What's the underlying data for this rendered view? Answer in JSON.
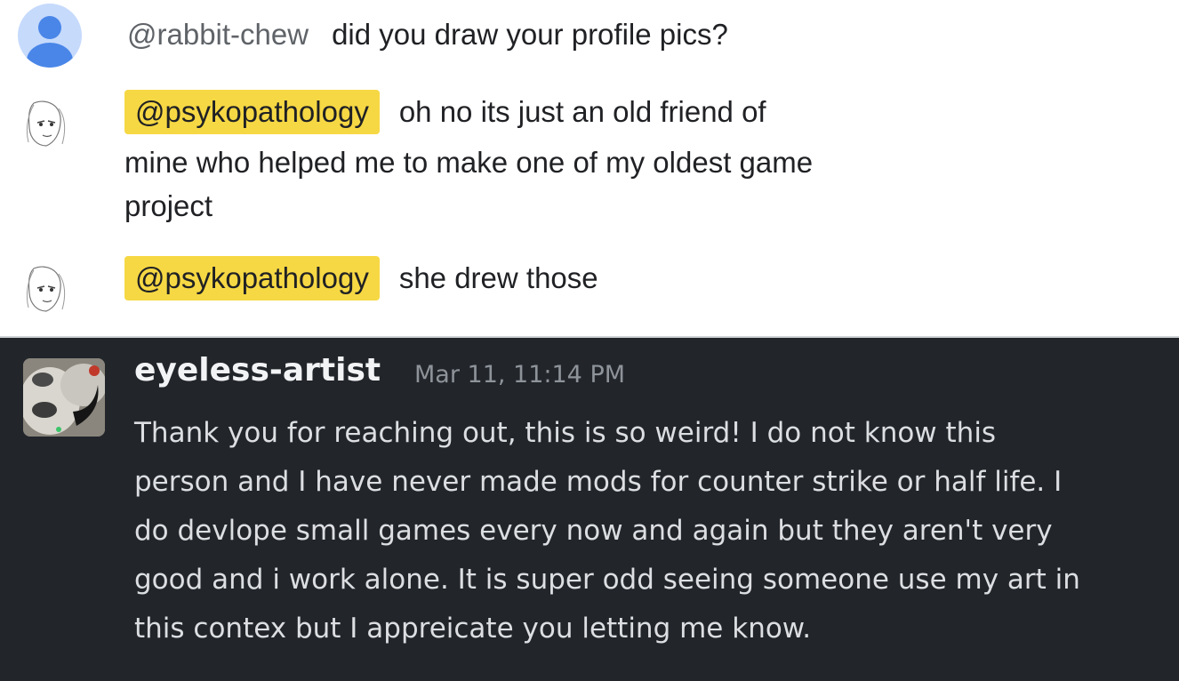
{
  "messages": [
    {
      "mention": "@rabbit-chew",
      "text": "did you draw your profile pics?"
    },
    {
      "mention": "@psykopathology",
      "lines": [
        "oh no its just an old friend of",
        "mine who helped me to make one of my oldest game",
        "project"
      ]
    },
    {
      "mention": "@psykopathology",
      "text": "she drew those"
    }
  ],
  "reply": {
    "username": "eyeless-artist",
    "timestamp": "Mar 11, 11:14 PM",
    "lines": [
      "Thank you for reaching out, this is so weird! I do not know this",
      "person and I have never made mods for counter strike or half life. I",
      "do devlope small games every now and again but they aren't very",
      "good and i work alone. It is super odd seeing someone use my art in",
      "this contex but I appreicate you letting me know."
    ]
  },
  "colors": {
    "mention_highlight": "#f6d844",
    "dark_bg": "#22262b",
    "avatar_blue": "#4a86e8"
  },
  "icons": {
    "generic": "default-user-avatar",
    "sketch": "sketch-portrait-avatar",
    "artist": "artist-avatar"
  }
}
